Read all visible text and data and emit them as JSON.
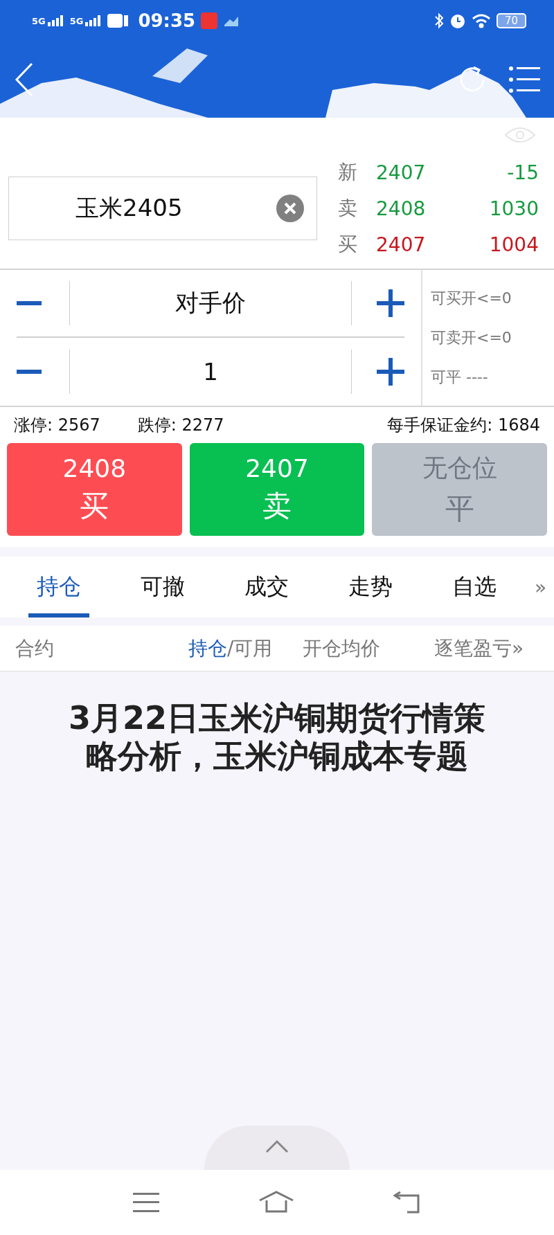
{
  "status_bar": {
    "signals": [
      "5G",
      "5G"
    ],
    "time": "09:35",
    "battery": "70"
  },
  "quote": {
    "search": {
      "value": "玉米2405"
    },
    "rows": [
      {
        "label": "新",
        "price": "2407",
        "change": "-15",
        "color": "#169a3e"
      },
      {
        "label": "卖",
        "price": "2408",
        "change": "1030",
        "color": "#169a3e"
      },
      {
        "label": "买",
        "price": "2407",
        "change": "1004",
        "color": "#c8161d"
      }
    ]
  },
  "steppers": [
    {
      "value": "对手价"
    },
    {
      "value": "1"
    }
  ],
  "availability": [
    "可买开<=0",
    "可卖开<=0",
    "可平 ----"
  ],
  "limits": {
    "up": "涨停: 2567",
    "down": "跌停: 2277",
    "margin": "每手保证金约: 1684"
  },
  "actions": [
    {
      "kind": "buy",
      "price": "2408",
      "label": "买",
      "disabled": false
    },
    {
      "kind": "sell",
      "price": "2407",
      "label": "卖",
      "disabled": false
    },
    {
      "kind": "close",
      "price": "无仓位",
      "label": "平",
      "disabled": true
    }
  ],
  "tabs": [
    {
      "label": "持仓",
      "selected": true
    },
    {
      "label": "可撤",
      "selected": false
    },
    {
      "label": "成交",
      "selected": false
    },
    {
      "label": "走势",
      "selected": false
    },
    {
      "label": "自选",
      "selected": false
    }
  ],
  "tabs_more": "»",
  "columns": [
    {
      "parts": [
        {
          "text": "合约",
          "selected": false
        }
      ]
    },
    {
      "parts": [
        {
          "text": "持仓",
          "selected": true
        },
        {
          "text": "/可用",
          "selected": false
        }
      ]
    },
    {
      "parts": [
        {
          "text": "开仓均价",
          "selected": false
        }
      ]
    },
    {
      "parts": [
        {
          "text": "逐笔盈亏",
          "selected": false
        }
      ]
    }
  ],
  "columns_more": "»",
  "headline": "3月22日玉米沪铜期货行情策略分析，玉米沪铜成本专题"
}
